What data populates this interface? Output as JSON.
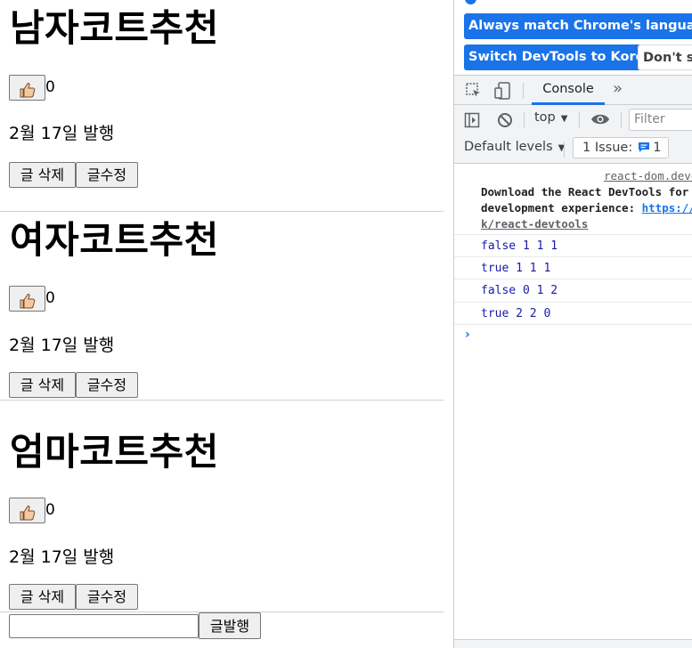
{
  "posts": [
    {
      "title": "남자코트추천",
      "like_count": "0",
      "date": "2월 17일 발행",
      "delete_label": "글 삭제",
      "edit_label": "글수정"
    },
    {
      "title": "여자코트추천",
      "like_count": "0",
      "date": "2월 17일 발행",
      "delete_label": "글 삭제",
      "edit_label": "글수정"
    },
    {
      "title": "엄마코트추천",
      "like_count": "0",
      "date": "2월 17일 발행",
      "delete_label": "글 삭제",
      "edit_label": "글수정"
    }
  ],
  "compose": {
    "input_value": "",
    "publish_label": "글발행"
  },
  "devtools": {
    "banner": {
      "match_language": "Always match Chrome's language",
      "switch_korean": "Switch DevTools to Korean",
      "dont_show": "Don't show again"
    },
    "tabs": {
      "console": "Console",
      "more": "»"
    },
    "toolbar": {
      "context": "top",
      "filter_placeholder": "Filter",
      "levels": "Default levels",
      "issues_label": "1 Issue:",
      "issues_count": "1"
    },
    "messages": {
      "react_source": "react-dom.development.js",
      "react_line1": "Download the React DevTools for a better",
      "react_line2_prefix": "development experience: ",
      "react_line2_link": "https://reactjs.org/lin",
      "react_line3": "k/react-devtools",
      "logs": [
        "false 1 1 1",
        "true 1 1 1",
        "false 0 1 2",
        "true 2 2 0"
      ],
      "prompt": "›"
    },
    "colors": {
      "accent": "#1a73e8",
      "log_text": "#1a1aa6",
      "panel_bg": "#f1f3f4"
    }
  }
}
